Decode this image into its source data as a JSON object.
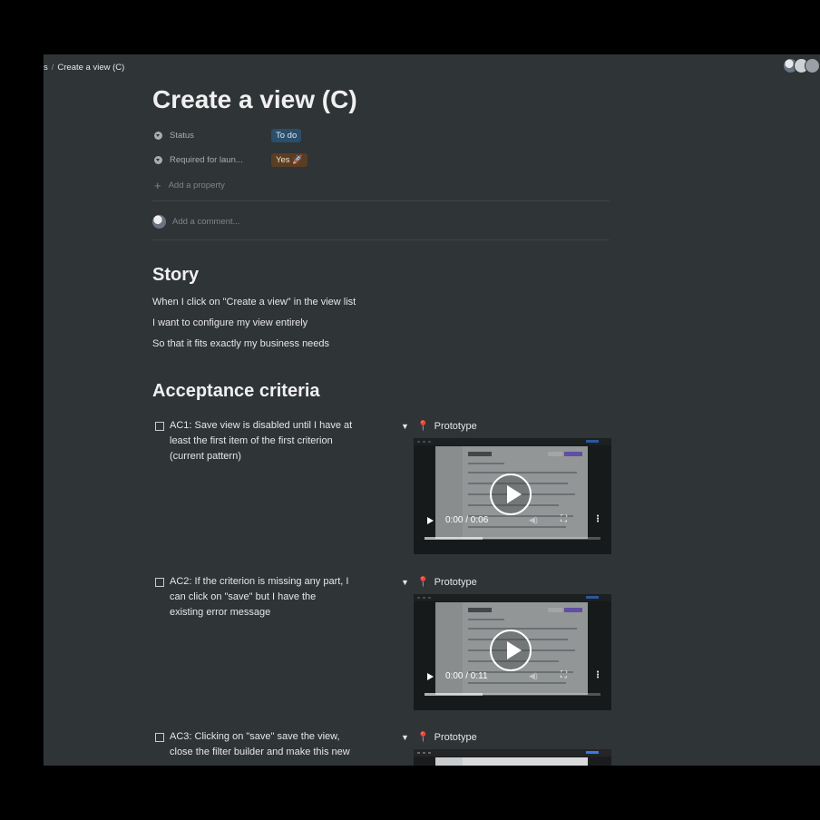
{
  "breadcrumb": {
    "parent": "s",
    "separator": "/",
    "current": "Create a view (C)"
  },
  "page": {
    "title": "Create a view (C)"
  },
  "properties": [
    {
      "label": "Status",
      "value": "To do",
      "color": "#2b4e6b"
    },
    {
      "label": "Required for laun...",
      "value": "Yes 🚀",
      "color": "#5a3e23"
    }
  ],
  "add_property_label": "Add a property",
  "comment": {
    "placeholder": "Add a comment..."
  },
  "story": {
    "heading": "Story",
    "lines": [
      "When I click on \"Create a view\" in the view list",
      "I want to configure my view entirely",
      "So that it fits exactly my business needs"
    ]
  },
  "acceptance": {
    "heading": "Acceptance criteria",
    "items": [
      {
        "lines": [
          "AC1: Save view is disabled until I have at",
          "least the first item of the first criterion",
          "(current pattern)"
        ],
        "toggle": "Prototype",
        "video": {
          "time": "0:00 / 0:06",
          "progress": 0.33
        }
      },
      {
        "lines": [
          "AC2: If the criterion is missing any part, I",
          "can click on \"save\" but I have the",
          "existing error message"
        ],
        "toggle": "Prototype",
        "video": {
          "time": "0:00 / 0:11",
          "progress": 0.33
        }
      },
      {
        "lines": [
          "AC3: Clicking on \"save\" save the view,",
          "close the filter builder and make this new"
        ],
        "toggle": "Prototype",
        "video": {
          "time": "",
          "progress": 0
        }
      }
    ]
  },
  "colors": {
    "background": "#2f3437",
    "text": "#e6e6e6",
    "muted": "#a9adb0"
  },
  "icons": {
    "property": "chevron-circle-icon",
    "add": "plus-icon",
    "toggle": "triangle-down-icon",
    "pin": "pushpin-icon"
  }
}
